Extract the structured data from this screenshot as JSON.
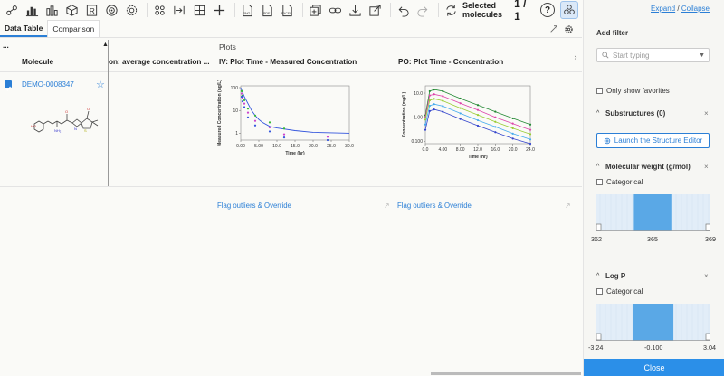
{
  "toolbar": {
    "icons": [
      "overview-icon",
      "bar-chart-icon",
      "stacked-chart-icon",
      "cube-icon",
      "r-script-icon",
      "target-icon",
      "settings-wheel-icon",
      "sequence-icon",
      "matrix-icon",
      "add-icon",
      "png-export-icon",
      "pdf-export-icon",
      "excel-export-icon",
      "duplicate-icon",
      "link-icon",
      "download-icon",
      "share-icon",
      "undo-icon",
      "redo-icon",
      "swap-icon"
    ],
    "png_label": "PNG",
    "pdf_label": "PDF",
    "excel_label": "EXCEL",
    "selected_label": "Selected molecules",
    "selected_count": "1 / 1",
    "help_label": "?"
  },
  "tabs": [
    {
      "label": "Data Table",
      "active": true
    },
    {
      "label": "Comparison",
      "active": false
    }
  ],
  "table": {
    "menu_label": "...",
    "columns": [
      {
        "label": "Molecule"
      },
      {
        "label": "on: average concentration ..."
      },
      {
        "label": "IV: Plot Time - Measured Concentration"
      },
      {
        "label": "PO: Plot Time - Concentration"
      }
    ],
    "section_label": "Plots",
    "row": {
      "id": "DEMO-0008347",
      "star": "☆"
    },
    "plot_link_label": "Flag outliers & Override"
  },
  "chart_data": [
    {
      "type": "scatter",
      "title": "",
      "xlabel": "Time (hr)",
      "ylabel": "Measured Concentration (ng/L)",
      "x_ticks": [
        "0.00",
        "5.00",
        "10.0",
        "15.0",
        "20.0",
        "25.0",
        "30.0"
      ],
      "y_ticks": [
        "1",
        "10",
        "100"
      ],
      "xlim": [
        0,
        30
      ],
      "ylim": [
        0.5,
        120
      ],
      "log_y": true,
      "series": [
        {
          "color": "#33bb33",
          "x": [
            0.25,
            0.5,
            1,
            2,
            4,
            8,
            12
          ],
          "y": [
            70,
            45,
            28,
            12,
            6,
            3,
            1.6
          ]
        },
        {
          "color": "#cc44cc",
          "x": [
            0.25,
            0.5,
            1,
            2,
            4,
            8,
            12,
            24
          ],
          "y": [
            55,
            35,
            20,
            8,
            3.5,
            1.8,
            0.9,
            0.7
          ]
        },
        {
          "color": "#3355dd",
          "x": [
            0.25,
            0.5,
            1,
            2,
            4,
            8,
            12,
            24
          ],
          "y": [
            40,
            25,
            14,
            5,
            2.2,
            1.2,
            0.65,
            0.5
          ]
        }
      ],
      "fit": {
        "color": "#3355dd",
        "x": [
          0,
          1,
          2,
          3,
          4,
          5,
          6,
          8,
          10,
          15,
          20,
          30
        ],
        "y": [
          100,
          40,
          20,
          10,
          6,
          4,
          3,
          2,
          1.7,
          1.3,
          1.1,
          1.0
        ]
      }
    },
    {
      "type": "line",
      "title": "",
      "xlabel": "Time (hr)",
      "ylabel": "Concentration (mg/L)",
      "x_ticks": [
        "0.0",
        "4.00",
        "8.00",
        "12.0",
        "16.0",
        "20.0",
        "24.0"
      ],
      "y_ticks": [
        "0.100",
        "1.00",
        "10.0"
      ],
      "xlim": [
        0,
        24
      ],
      "ylim": [
        0.08,
        20
      ],
      "log_y": true,
      "series": [
        {
          "color": "#228833",
          "x": [
            0,
            1,
            2,
            4,
            8,
            12,
            16,
            20,
            24
          ],
          "y": [
            1.2,
            12,
            14,
            12,
            6,
            3.2,
            1.7,
            0.9,
            0.5
          ]
        },
        {
          "color": "#dd44aa",
          "x": [
            0,
            1,
            2,
            4,
            8,
            12,
            16,
            20,
            24
          ],
          "y": [
            1.0,
            8,
            9,
            7.5,
            3.8,
            2.0,
            1.0,
            0.55,
            0.3
          ]
        },
        {
          "color": "#99cc33",
          "x": [
            0,
            1,
            2,
            4,
            8,
            12,
            16,
            20,
            24
          ],
          "y": [
            0.8,
            5,
            5.8,
            4.8,
            2.4,
            1.25,
            0.65,
            0.35,
            0.2
          ]
        },
        {
          "color": "#44aaee",
          "x": [
            0,
            1,
            2,
            4,
            8,
            12,
            16,
            20,
            24
          ],
          "y": [
            0.5,
            3,
            3.5,
            2.9,
            1.45,
            0.75,
            0.4,
            0.21,
            0.12
          ]
        },
        {
          "color": "#3344cc",
          "x": [
            0,
            1,
            2,
            4,
            8,
            12,
            16,
            20,
            24
          ],
          "y": [
            0.3,
            1.8,
            2.1,
            1.7,
            0.85,
            0.45,
            0.24,
            0.13,
            0.08
          ]
        }
      ]
    }
  ],
  "sidebar": {
    "expand_label": "Expand",
    "slash": "/",
    "collapse_label": "Collapse",
    "add_filter_label": "Add filter",
    "search_placeholder": "Start typing",
    "show_favorites_label": "Only show favorites",
    "substructures_label": "Substructures (0)",
    "launch_label": "Launch the Structure Editor",
    "mw_label": "Molecular weight (g/mol)",
    "categorical_label": "Categorical",
    "mw_ticks": [
      "362",
      "365",
      "369"
    ],
    "mw_range": [
      362,
      369
    ],
    "mw_selected": [
      364.3,
      366.6
    ],
    "logp_label": "Log P",
    "logp_ticks": [
      "-3.24",
      "-0.100",
      "3.04"
    ],
    "logp_range": [
      -3.24,
      3.04
    ],
    "logp_selected": [
      -1.2,
      1.0
    ],
    "close_label": "Close",
    "close_x": "×",
    "accent": "#2b8fe8",
    "selected_color": "#5aa8e6"
  }
}
